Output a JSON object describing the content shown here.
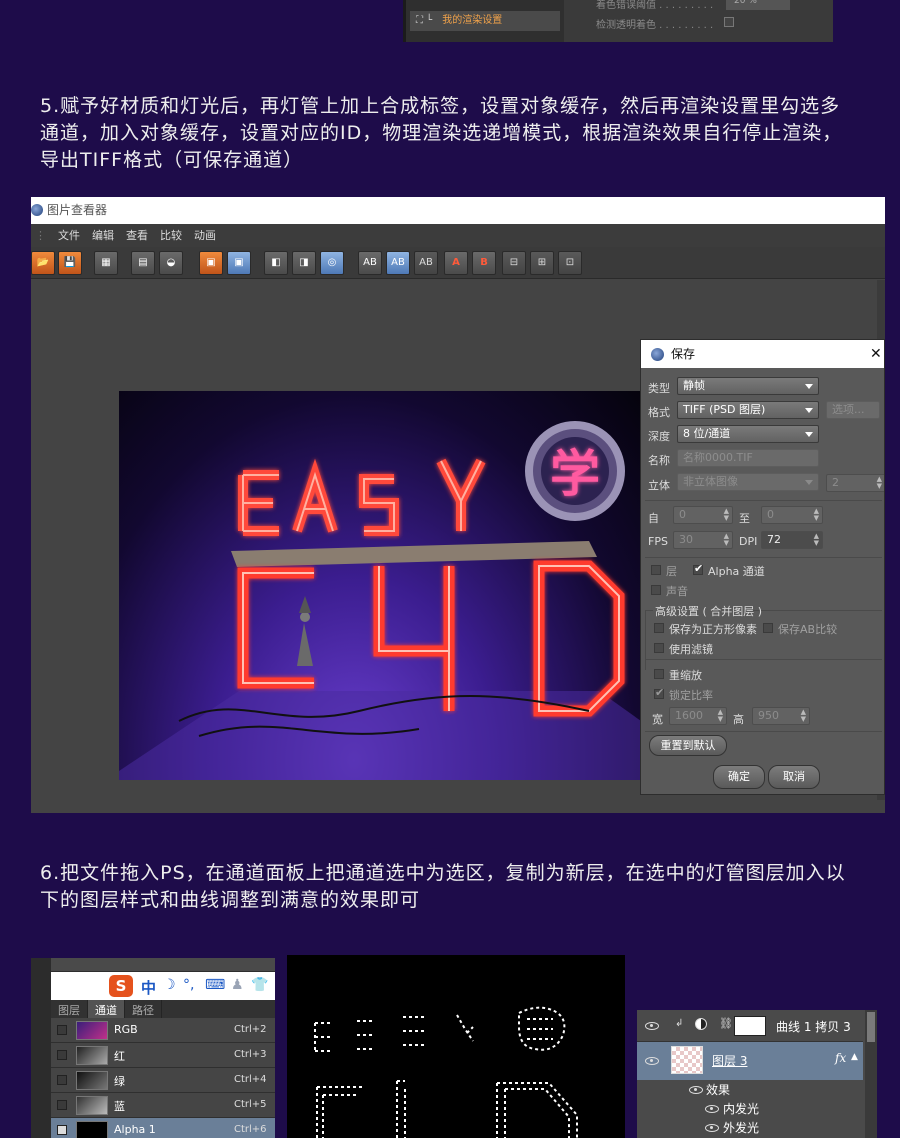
{
  "top_panel": {
    "tree_item": "我的渲染设置",
    "row1_label": "着色错误阈值 . . . . . . . . .",
    "row1_value": "20 %",
    "row2_label": "检测透明着色 . . . . . . . . ."
  },
  "step5_text": "5.赋予好材质和灯光后，再灯管上加上合成标签，设置对象缓存，然后再渲染设置里勾选多通道，加入对象缓存，设置对应的ID，物理渲染选递增模式，根据渲染效果自行停止渲染，导出TIFF格式（可保存通道）",
  "step6_text": "6.把文件拖入PS，在通道面板上把通道选中为选区，复制为新层，在选中的灯管图层加入以下的图层样式和曲线调整到满意的效果即可",
  "viewer": {
    "title": "图片查看器",
    "menu": [
      "文件",
      "编辑",
      "查看",
      "比较",
      "动画"
    ],
    "toolbar_glyphs": [
      "AB",
      "AB",
      "AB",
      "A",
      "B"
    ],
    "render_letters": [
      "E",
      "A",
      "S",
      "Y"
    ],
    "render_badge": "学",
    "render_big": [
      "C",
      "4",
      "D"
    ]
  },
  "save_dialog": {
    "title": "保存",
    "close": "✕",
    "type_label": "类型",
    "type_value": "静帧",
    "format_label": "格式",
    "format_value": "TIFF (PSD 图层)",
    "options_button": "选项...",
    "depth_label": "深度",
    "depth_value": "8 位/通道",
    "name_label": "名称",
    "name_value": "名称0000.TIF",
    "stereo_label": "立体",
    "stereo_value": "非立体图像",
    "stereo_count": "2",
    "from_label": "自",
    "from_value": "0",
    "to_label": "至",
    "to_value": "0",
    "fps_label": "FPS",
    "fps_value": "30",
    "dpi_label": "DPI",
    "dpi_value": "72",
    "layers_label": "层",
    "alpha_label": "Alpha 通道",
    "sound_label": "声音",
    "advanced_label": "高级设置 ( 合并图层 )",
    "square_pixels_label": "保存为正方形像素",
    "ab_ratio_label": "保存AB比较",
    "use_filter_label": "使用滤镜",
    "rescale_label": "重缩放",
    "lock_ratio_label": "锁定比率",
    "width_label": "宽",
    "width_value": "1600",
    "height_label": "高",
    "height_value": "950",
    "reset_button": "重置到默认",
    "ok_button": "确定",
    "cancel_button": "取消"
  },
  "channels_panel": {
    "ime_logo": "S",
    "ime_lang": "中",
    "tabs": [
      "图层",
      "通道",
      "路径"
    ],
    "rows": [
      {
        "name": "RGB",
        "shortcut": "Ctrl+2"
      },
      {
        "name": "红",
        "shortcut": "Ctrl+3"
      },
      {
        "name": "绿",
        "shortcut": "Ctrl+4"
      },
      {
        "name": "蓝",
        "shortcut": "Ctrl+5"
      },
      {
        "name": "Alpha 1",
        "shortcut": "Ctrl+6"
      }
    ]
  },
  "layers_panel": {
    "curves_layer": "曲线 1 拷贝 3",
    "layer_name": "图层 3",
    "fx": "fx",
    "effects_label": "效果",
    "effect_1": "内发光",
    "effect_2": "外发光"
  },
  "colors": {
    "background": "#1e0c4a",
    "neon": "#ff4a3a",
    "accent_orange": "#f0a24a",
    "selection_blue": "#6a7f98"
  }
}
